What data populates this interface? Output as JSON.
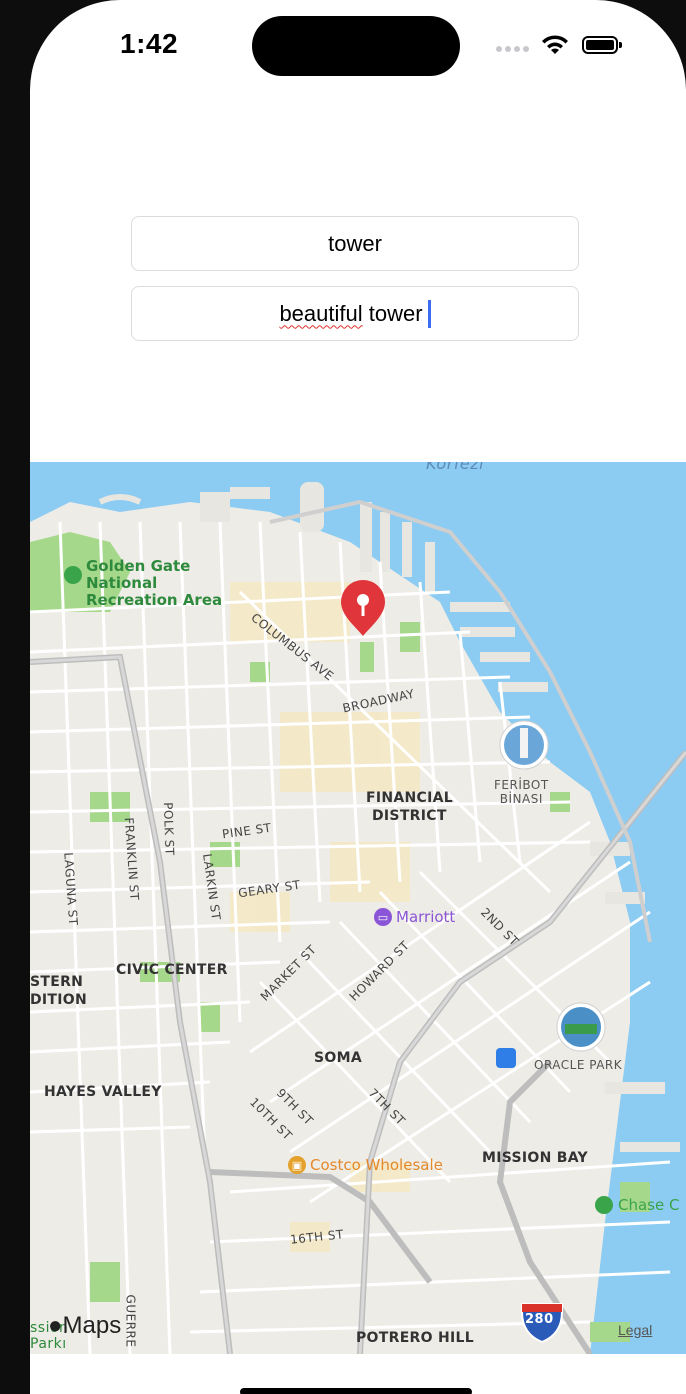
{
  "status_bar": {
    "time": "1:42"
  },
  "form": {
    "title_value": "tower",
    "subtitle_value_misspelled": "beautiful",
    "subtitle_value_rest": " tower"
  },
  "map": {
    "districts": [
      "FINANCIAL",
      "DISTRICT",
      "CIVIC CENTER",
      "SOMA",
      "HAYES VALLEY",
      "MISSION BAY",
      "POTRERO HILL",
      "STERN",
      "DITION"
    ],
    "streets": [
      "COLUMBUS AVE",
      "BROADWAY",
      "PINE ST",
      "GEARY ST",
      "MARKET ST",
      "HOWARD ST",
      "2ND ST",
      "9TH ST",
      "10TH ST",
      "7TH ST",
      "16TH ST",
      "POLK ST",
      "LARKIN ST",
      "FRANKLIN ST",
      "LAGUNA ST",
      "GUERRE"
    ],
    "park": [
      "Golden Gate",
      "National",
      "Recreation Area"
    ],
    "pois": {
      "marriott": "Marriott",
      "costco": "Costco Wholesale",
      "chase": "Chase C",
      "ferry_line1": "FERİBOT",
      "ferry_line2": "BİNASI",
      "oracle": "ORACLE PARK",
      "interstate": "280",
      "water_label": "Körfezi",
      "bottom_left_park": "ssion",
      "bottom_left_park2": "Parkı"
    },
    "attribution": {
      "logo": "Maps",
      "legal": "Legal"
    },
    "colors": {
      "water": "#8ccbf2",
      "land": "#eeece6",
      "park": "#a6d88c",
      "pin": "#e0353a"
    }
  }
}
